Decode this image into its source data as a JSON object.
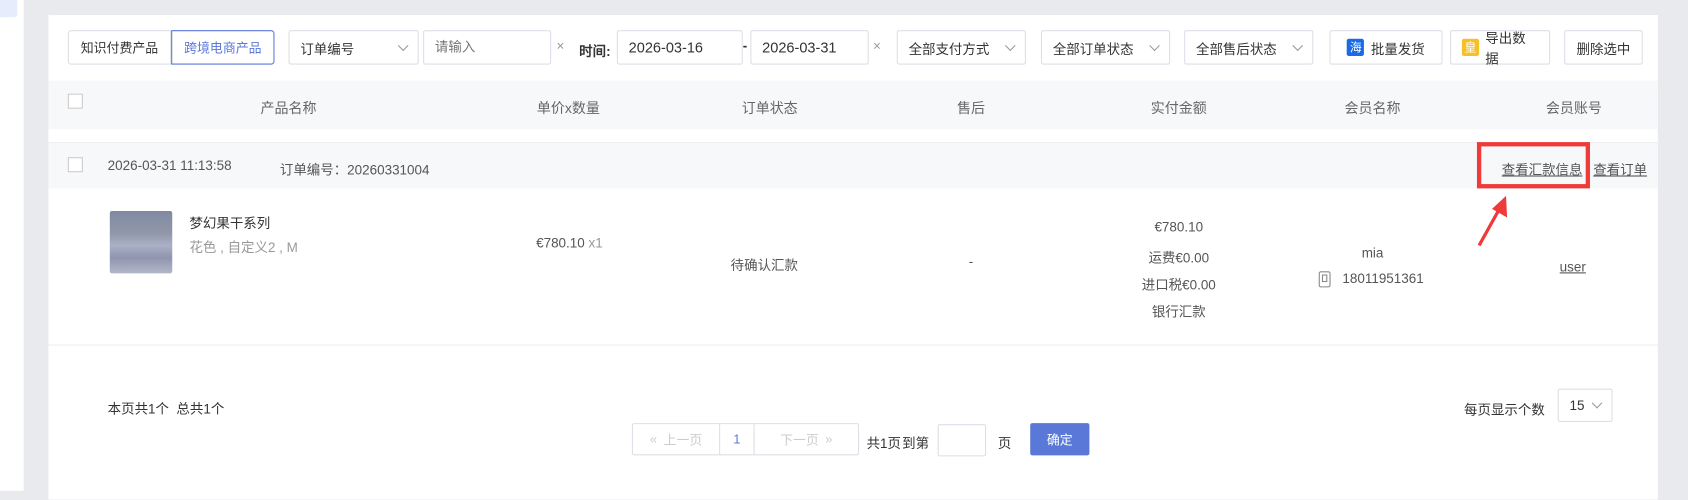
{
  "filters": {
    "tabs": [
      "知识付费产品",
      "跨境电商产品"
    ],
    "search_type": "订单编号",
    "search_placeholder": "请输入",
    "time_label": "时间:",
    "date_from": "2026-03-16",
    "date_sep": "-",
    "date_to": "2026-03-31",
    "clear": "×",
    "payment_method": "全部支付方式",
    "order_status": "全部订单状态",
    "after_sale_status": "全部售后状态",
    "bulk_ship": "批量发货",
    "bulk_ship_icon": "海",
    "export": "导出数据",
    "export_icon": "皇",
    "delete_selected": "删除选中"
  },
  "table": {
    "columns": [
      "产品名称",
      "单价x数量",
      "订单状态",
      "售后",
      "实付金额",
      "会员名称",
      "会员账号"
    ],
    "orders": [
      {
        "datetime": "2026-03-31 11:13:58",
        "order_no": "订单编号：20260331004",
        "view_remittance": "查看汇款信息",
        "view_order": "查看订单",
        "product_name": "梦幻果干系列",
        "product_spec": "花色 , 自定义2 , M",
        "price": "€780.10",
        "qty": "x1",
        "status": "待确认汇款",
        "after_sale": "-",
        "paid": "€780.10",
        "shipping": "运费€0.00",
        "import_tax": "进口税€0.00",
        "pay_method": "银行汇款",
        "member_name": "mia",
        "member_phone": "18011951361",
        "member_account": "user"
      }
    ]
  },
  "footer": {
    "summary": "本页共1个  总共1个",
    "page_size_label": "每页显示个数",
    "page_size": "15",
    "prev": "上一页",
    "current_page": "1",
    "next": "下一页",
    "total_pages": "共1页",
    "goto_label": "到第",
    "goto_suffix": "页",
    "confirm": "确定"
  },
  "colors": {
    "accent": "#5a78d8",
    "highlight": "#f03a3a"
  }
}
